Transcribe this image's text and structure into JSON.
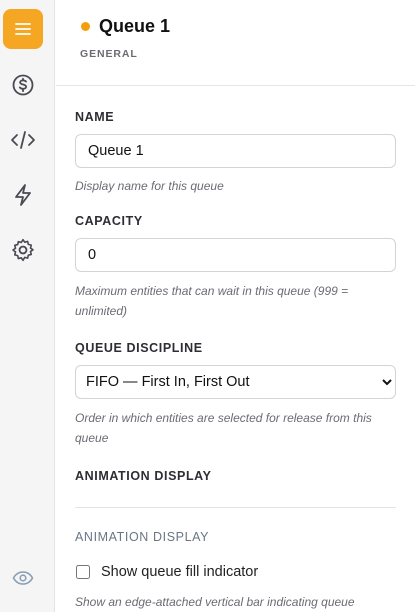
{
  "rail": {
    "items": [
      {
        "icon": "menu-icon",
        "active": true
      },
      {
        "icon": "dollar-icon",
        "active": false
      },
      {
        "icon": "code-icon",
        "active": false
      },
      {
        "icon": "lightning-icon",
        "active": false
      },
      {
        "icon": "gear-icon",
        "active": false
      }
    ],
    "bottom_icon": "eye-icon",
    "accent": "#f5a623"
  },
  "header": {
    "title": "Queue 1",
    "subtitle": "GENERAL",
    "status_color": "#f59e0b"
  },
  "fields": {
    "name": {
      "label": "NAME",
      "value": "Queue 1",
      "help": "Display name for this queue"
    },
    "capacity": {
      "label": "CAPACITY",
      "value": "0",
      "help": "Maximum entities that can wait in this queue (999 = unlimited)"
    },
    "discipline": {
      "label": "QUEUE DISCIPLINE",
      "selected": "FIFO — First In, First Out",
      "help": "Order in which entities are selected for release from this queue"
    }
  },
  "animation": {
    "heading": "ANIMATION DISPLAY",
    "section_title": "ANIMATION DISPLAY",
    "fill_indicator_label": "Show queue fill indicator",
    "fill_indicator_checked": false,
    "fill_indicator_help": "Show an edge-attached vertical bar indicating queue"
  }
}
